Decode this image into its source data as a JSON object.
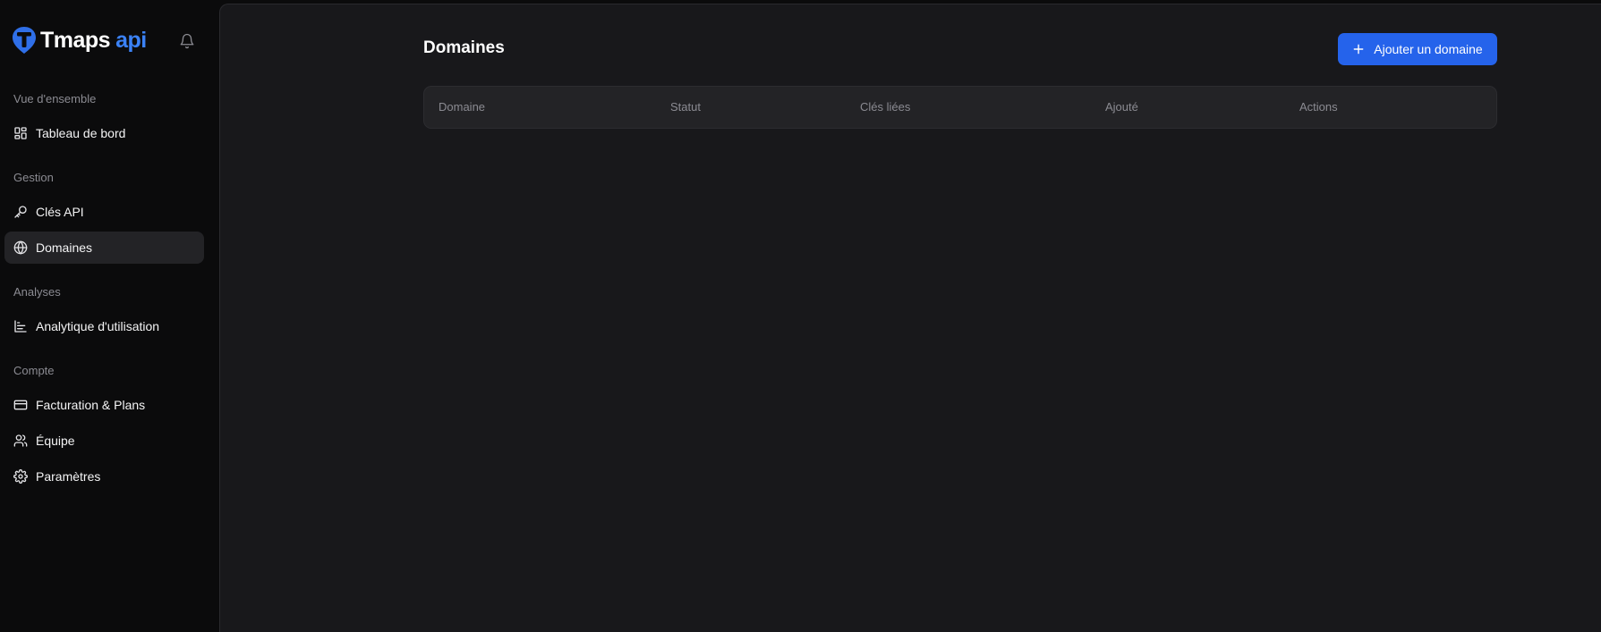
{
  "brand": {
    "name": "Tmaps",
    "suffix": "api"
  },
  "sidebar": {
    "sections": [
      {
        "label": "Vue d'ensemble"
      },
      {
        "label": "Gestion"
      },
      {
        "label": "Analyses"
      },
      {
        "label": "Compte"
      }
    ],
    "items": [
      {
        "label": "Tableau de bord",
        "icon": "dashboard-icon"
      },
      {
        "label": "Clés API",
        "icon": "key-icon"
      },
      {
        "label": "Domaines",
        "icon": "globe-icon",
        "active": true
      },
      {
        "label": "Analytique d'utilisation",
        "icon": "chart-icon"
      },
      {
        "label": "Facturation & Plans",
        "icon": "credit-card-icon"
      },
      {
        "label": "Équipe",
        "icon": "users-icon"
      },
      {
        "label": "Paramètres",
        "icon": "gear-icon"
      }
    ]
  },
  "main": {
    "title": "Domaines",
    "add_button_label": "Ajouter un domaine",
    "table": {
      "columns": [
        "Domaine",
        "Statut",
        "Clés liées",
        "Ajouté",
        "Actions"
      ],
      "rows": []
    }
  },
  "colors": {
    "accent": "#2563eb",
    "brand_api": "#3b82f6",
    "sidebar_bg": "#0b0b0c",
    "panel_bg": "#18181b",
    "table_header_bg": "#232326"
  }
}
